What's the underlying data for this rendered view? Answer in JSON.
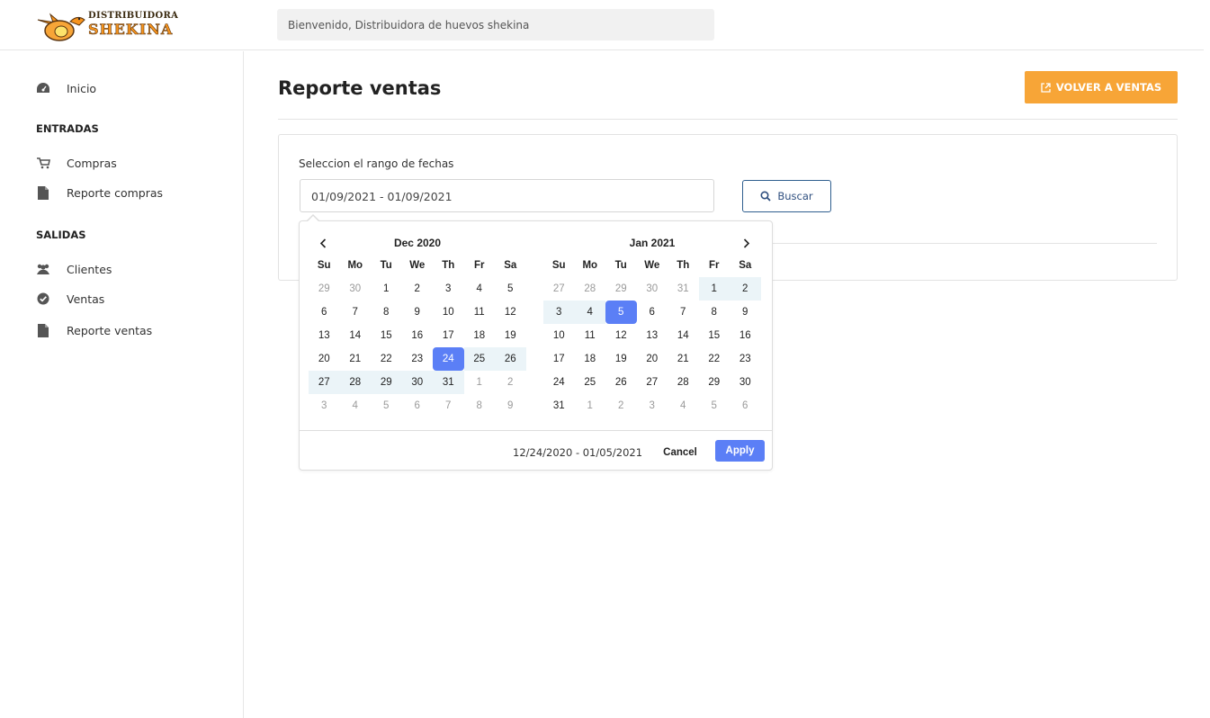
{
  "header": {
    "logo_line1": "Distribuidora",
    "logo_line2": "Shekina",
    "welcome_text": "Bienvenido, Distribuidora de huevos shekina"
  },
  "sidebar": {
    "inicio": "Inicio",
    "section_entradas": "ENTRADAS",
    "compras": "Compras",
    "reporte_compras": "Reporte compras",
    "section_salidas": "SALIDAS",
    "clientes": "Clientes",
    "ventas": "Ventas",
    "reporte_ventas": "Reporte ventas"
  },
  "main": {
    "title": "Reporte ventas",
    "volver_label": "VOLVER A VENTAS",
    "range_label": "Seleccion el rango de fechas",
    "range_value": "01/09/2021 - 01/09/2021",
    "buscar_label": "Buscar"
  },
  "datepicker": {
    "dow": [
      "Su",
      "Mo",
      "Tu",
      "We",
      "Th",
      "Fr",
      "Sa"
    ],
    "left": {
      "title": "Dec 2020",
      "weeks": [
        [
          [
            "29",
            "off"
          ],
          [
            "30",
            "off"
          ],
          [
            "1",
            ""
          ],
          [
            "2",
            ""
          ],
          [
            "3",
            ""
          ],
          [
            "4",
            ""
          ],
          [
            "5",
            ""
          ]
        ],
        [
          [
            "6",
            ""
          ],
          [
            "7",
            ""
          ],
          [
            "8",
            ""
          ],
          [
            "9",
            ""
          ],
          [
            "10",
            ""
          ],
          [
            "11",
            ""
          ],
          [
            "12",
            ""
          ]
        ],
        [
          [
            "13",
            ""
          ],
          [
            "14",
            ""
          ],
          [
            "15",
            ""
          ],
          [
            "16",
            ""
          ],
          [
            "17",
            ""
          ],
          [
            "18",
            ""
          ],
          [
            "19",
            ""
          ]
        ],
        [
          [
            "20",
            ""
          ],
          [
            "21",
            ""
          ],
          [
            "22",
            ""
          ],
          [
            "23",
            ""
          ],
          [
            "24",
            "active"
          ],
          [
            "25",
            "in-range"
          ],
          [
            "26",
            "in-range"
          ]
        ],
        [
          [
            "27",
            "in-range"
          ],
          [
            "28",
            "in-range"
          ],
          [
            "29",
            "in-range"
          ],
          [
            "30",
            "in-range"
          ],
          [
            "31",
            "in-range"
          ],
          [
            "1",
            "off"
          ],
          [
            "2",
            "off"
          ]
        ],
        [
          [
            "3",
            "off"
          ],
          [
            "4",
            "off"
          ],
          [
            "5",
            "off"
          ],
          [
            "6",
            "off"
          ],
          [
            "7",
            "off"
          ],
          [
            "8",
            "off"
          ],
          [
            "9",
            "off"
          ]
        ]
      ]
    },
    "right": {
      "title": "Jan 2021",
      "weeks": [
        [
          [
            "27",
            "off"
          ],
          [
            "28",
            "off"
          ],
          [
            "29",
            "off"
          ],
          [
            "30",
            "off"
          ],
          [
            "31",
            "off"
          ],
          [
            "1",
            "in-range"
          ],
          [
            "2",
            "in-range"
          ]
        ],
        [
          [
            "3",
            "in-range"
          ],
          [
            "4",
            "in-range"
          ],
          [
            "5",
            "active"
          ],
          [
            "6",
            ""
          ],
          [
            "7",
            ""
          ],
          [
            "8",
            ""
          ],
          [
            "9",
            ""
          ]
        ],
        [
          [
            "10",
            ""
          ],
          [
            "11",
            ""
          ],
          [
            "12",
            ""
          ],
          [
            "13",
            ""
          ],
          [
            "14",
            ""
          ],
          [
            "15",
            ""
          ],
          [
            "16",
            ""
          ]
        ],
        [
          [
            "17",
            ""
          ],
          [
            "18",
            ""
          ],
          [
            "19",
            ""
          ],
          [
            "20",
            ""
          ],
          [
            "21",
            ""
          ],
          [
            "22",
            ""
          ],
          [
            "23",
            ""
          ]
        ],
        [
          [
            "24",
            ""
          ],
          [
            "25",
            ""
          ],
          [
            "26",
            ""
          ],
          [
            "27",
            ""
          ],
          [
            "28",
            ""
          ],
          [
            "29",
            ""
          ],
          [
            "30",
            ""
          ]
        ],
        [
          [
            "31",
            ""
          ],
          [
            "1",
            "off"
          ],
          [
            "2",
            "off"
          ],
          [
            "3",
            "off"
          ],
          [
            "4",
            "off"
          ],
          [
            "5",
            "off"
          ],
          [
            "6",
            "off"
          ]
        ]
      ]
    },
    "selected_text": "12/24/2020 - 01/05/2021",
    "cancel_label": "Cancel",
    "apply_label": "Apply"
  },
  "colors": {
    "accent_orange": "#f7a537",
    "accent_blue": "#5b7ff6",
    "range_bg": "#ebf4f8"
  }
}
